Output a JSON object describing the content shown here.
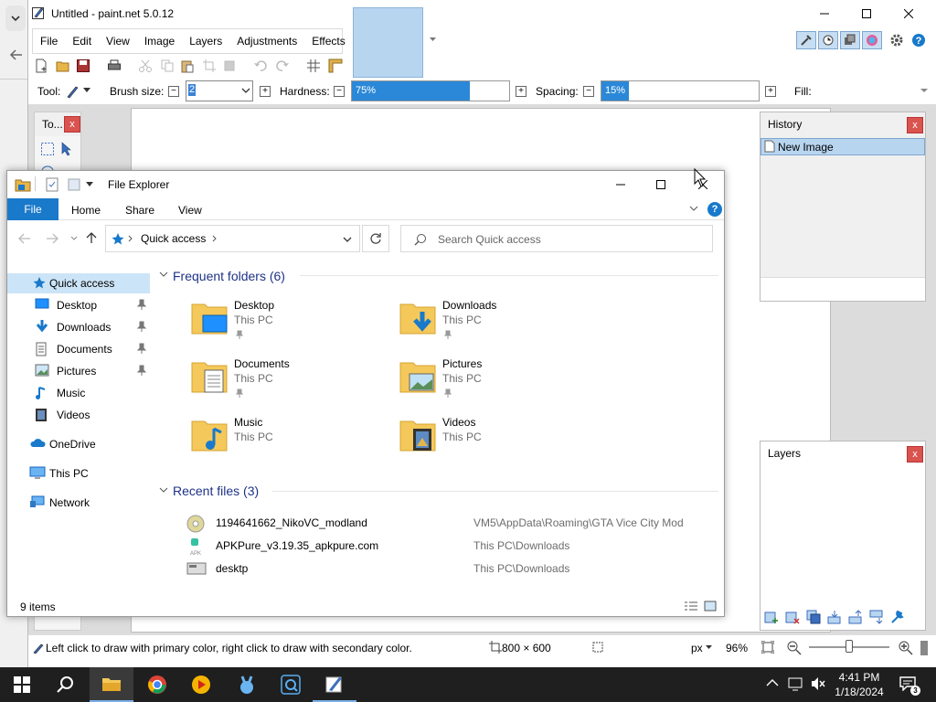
{
  "pdn": {
    "title": "Untitled - paint.net 5.0.12",
    "menus": [
      "File",
      "Edit",
      "View",
      "Image",
      "Layers",
      "Adjustments",
      "Effects"
    ],
    "tool_label": "Tool:",
    "brush_size_label": "Brush size:",
    "brush_size_value": "2",
    "hardness_label": "Hardness:",
    "hardness_value": "75%",
    "hardness_fraction": 0.75,
    "spacing_label": "Spacing:",
    "spacing_value": "15%",
    "spacing_fraction": 0.15,
    "fill_label": "Fill:",
    "tools_title": "To...",
    "history_title": "History",
    "history_item": "New Image",
    "layers_title": "Layers",
    "status_hint": "Left click to draw with primary color, right click to draw with secondary color.",
    "image_size": "800 × 600",
    "units": "px",
    "zoom": "96%",
    "accent": "#2b88d8"
  },
  "explorer": {
    "title": "File Explorer",
    "tabs": {
      "file": "File",
      "home": "Home",
      "share": "Share",
      "view": "View"
    },
    "address": "Quick access",
    "search_placeholder": "Search Quick access",
    "nav": {
      "quick": "Quick access",
      "desktop": "Desktop",
      "downloads": "Downloads",
      "documents": "Documents",
      "pictures": "Pictures",
      "music": "Music",
      "videos": "Videos",
      "onedrive": "OneDrive",
      "thispc": "This PC",
      "network": "Network"
    },
    "frequent_header": "Frequent folders (6)",
    "frequent": [
      {
        "name": "Desktop",
        "location": "This PC"
      },
      {
        "name": "Downloads",
        "location": "This PC"
      },
      {
        "name": "Documents",
        "location": "This PC"
      },
      {
        "name": "Pictures",
        "location": "This PC"
      },
      {
        "name": "Music",
        "location": "This PC"
      },
      {
        "name": "Videos",
        "location": "This PC"
      }
    ],
    "recent_header": "Recent files (3)",
    "recent": [
      {
        "name": "1194641662_NikoVC_modland",
        "path": "VM5\\AppData\\Roaming\\GTA Vice City Mod"
      },
      {
        "name": "APKPure_v3.19.35_apkpure.com",
        "path": "This PC\\Downloads"
      },
      {
        "name": "desktp",
        "path": "This PC\\Downloads"
      }
    ],
    "status": "9 items",
    "accent": "#1979ca"
  },
  "taskbar": {
    "time": "4:41 PM",
    "date": "1/18/2024",
    "notifications": "3"
  }
}
